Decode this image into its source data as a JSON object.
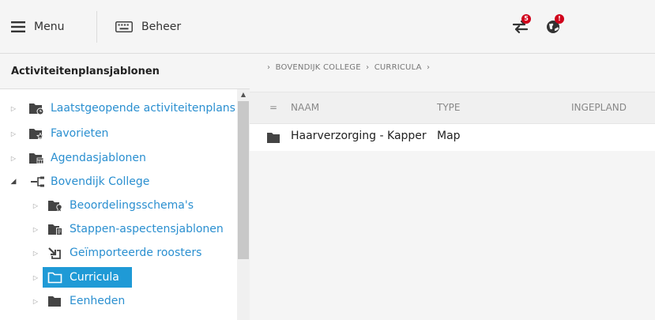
{
  "toolbar": {
    "menu_label": "Menu",
    "beheer_label": "Beheer",
    "swap_badge": "5",
    "globe_badge": "!",
    "icons": {
      "menu": "hamburger-icon",
      "beheer": "keyboard-icon",
      "swap": "swap-arrows-icon",
      "globe": "globe-icon"
    },
    "badge_color": "#d0021b"
  },
  "left_panel": {
    "title": "Activiteitenplansjablonen",
    "tree": [
      {
        "label": "Laatstgeopende activiteitenplans",
        "icon": "folder-clock-icon",
        "expanded": false
      },
      {
        "label": "Favorieten",
        "icon": "folder-star-icon",
        "expanded": false
      },
      {
        "label": "Agendasjablonen",
        "icon": "folder-calendar-icon",
        "expanded": false
      },
      {
        "label": "Bovendijk College",
        "icon": "hierarchy-icon",
        "expanded": true
      },
      {
        "label": "Beoordelingsschema's",
        "icon": "folder-award-icon",
        "expanded": false
      },
      {
        "label": "Stappen-aspectensjablonen",
        "icon": "folder-document-icon",
        "expanded": false
      },
      {
        "label": "Geïmporteerde roosters",
        "icon": "import-icon",
        "expanded": false
      },
      {
        "label": "Curricula",
        "icon": "folder-open-icon",
        "expanded": false,
        "selected": true
      },
      {
        "label": "Eenheden",
        "icon": "folder-icon",
        "expanded": false
      }
    ],
    "link_color": "#2a8fd0",
    "selected_color": "#1f9ad6"
  },
  "right_panel": {
    "breadcrumb": [
      "BOVENDIJK COLLEGE",
      "CURRICULA"
    ],
    "columns": {
      "sort": "=",
      "name": "NAAM",
      "type": "TYPE",
      "planned": "INGEPLAND"
    },
    "rows": [
      {
        "icon": "folder-icon",
        "name": "Haarverzorging - Kapper",
        "type": "Map"
      }
    ]
  }
}
